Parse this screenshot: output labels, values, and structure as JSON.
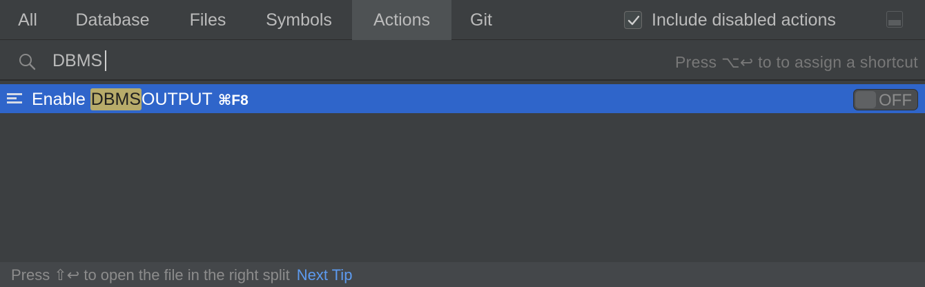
{
  "tabs": [
    {
      "label": "All"
    },
    {
      "label": "Database"
    },
    {
      "label": "Files"
    },
    {
      "label": "Symbols"
    },
    {
      "label": "Actions",
      "active": true
    },
    {
      "label": "Git"
    }
  ],
  "include_disabled": {
    "label": "Include disabled actions",
    "checked": true
  },
  "search": {
    "value": "DBMS",
    "placeholder": ""
  },
  "hint": "Press ⌥↩ to to assign a shortcut",
  "results": [
    {
      "prefix": "Enable ",
      "match": "DBMS",
      "suffix": "OUTPUT",
      "shortcut": "⌘F8",
      "toggle": "OFF",
      "icon": "action-list-icon"
    }
  ],
  "footer": {
    "text": "Press ⇧↩ to open the file in the right split",
    "link": "Next Tip"
  },
  "colors": {
    "selection": "#2f65ca",
    "highlight": "#b7ab6a",
    "link": "#5d9bf0",
    "background": "#3c3f41"
  }
}
